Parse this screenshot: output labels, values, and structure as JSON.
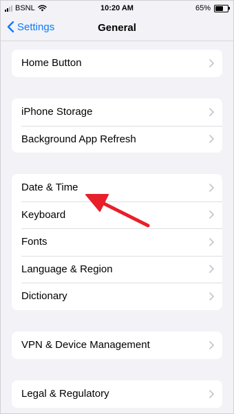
{
  "status_bar": {
    "carrier": "BSNL",
    "time": "10:20 AM",
    "battery_percent": "65%",
    "battery_level": 0.65
  },
  "nav": {
    "back_label": "Settings",
    "title": "General"
  },
  "groups": [
    {
      "items": [
        {
          "label": "Home Button"
        }
      ]
    },
    {
      "items": [
        {
          "label": "iPhone Storage"
        },
        {
          "label": "Background App Refresh"
        }
      ]
    },
    {
      "items": [
        {
          "label": "Date & Time"
        },
        {
          "label": "Keyboard"
        },
        {
          "label": "Fonts"
        },
        {
          "label": "Language & Region"
        },
        {
          "label": "Dictionary"
        }
      ]
    },
    {
      "items": [
        {
          "label": "VPN & Device Management"
        }
      ]
    },
    {
      "items": [
        {
          "label": "Legal & Regulatory"
        }
      ]
    }
  ],
  "colors": {
    "accent": "#0a7aff",
    "background": "#f2f2f7",
    "annotation_arrow": "#e8202a"
  },
  "icons": [
    "signal-icon",
    "wifi-icon",
    "battery-icon",
    "chevron-left-icon",
    "chevron-right-icon"
  ]
}
